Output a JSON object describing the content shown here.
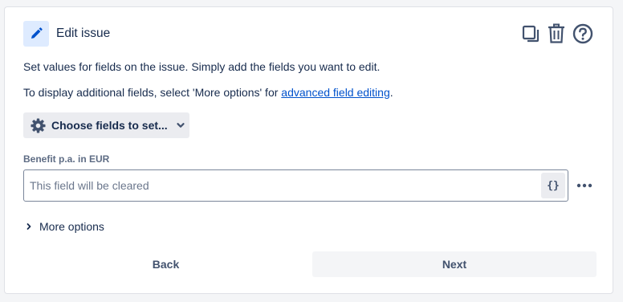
{
  "header": {
    "title": "Edit issue",
    "icon": "pencil-icon",
    "actions": [
      {
        "icon": "copy-icon"
      },
      {
        "icon": "trash-icon"
      },
      {
        "icon": "help-icon"
      }
    ]
  },
  "description": {
    "line1": "Set values for fields on the issue. Simply add the fields you want to edit.",
    "line2_prefix": "To display additional fields, select 'More options' for ",
    "line2_link": "advanced field editing",
    "line2_suffix": "."
  },
  "choose_fields": {
    "label": "Choose fields to set...",
    "icon": "gear-icon",
    "chevron": "chevron-down-icon"
  },
  "field": {
    "label": "Benefit p.a. in EUR",
    "value": "",
    "placeholder": "This field will be cleared",
    "smart_value_label": "{}",
    "more_icon": "more-horizontal-icon"
  },
  "more_options": {
    "label": "More options",
    "icon": "chevron-right-icon"
  },
  "footer": {
    "back_label": "Back",
    "next_label": "Next"
  },
  "colors": {
    "accent": "#0052cc",
    "icon_bg": "#deebff",
    "button_bg": "#ebecf0",
    "text": "#172b4d"
  }
}
